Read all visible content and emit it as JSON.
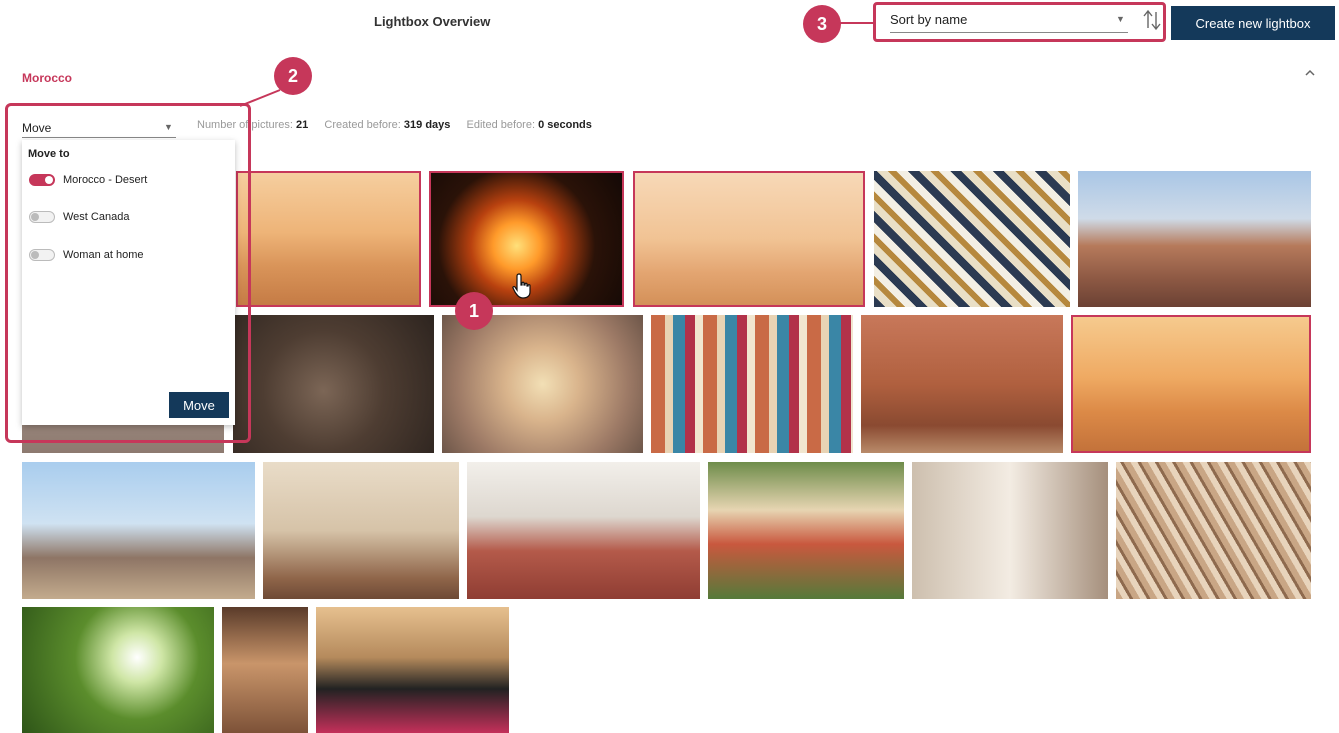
{
  "header": {
    "title": "Lightbox Overview",
    "sort_value": "Sort by name",
    "create_button": "Create new lightbox"
  },
  "callouts": {
    "one": "1",
    "two": "2",
    "three": "3"
  },
  "lightbox": {
    "name": "Morocco",
    "meta": {
      "pictures_label": "Number of pictures:",
      "pictures_value": "21",
      "created_label": "Created before:",
      "created_value": "319 days",
      "edited_label": "Edited before:",
      "edited_value": "0 seconds"
    }
  },
  "move_menu": {
    "select_value": "Move",
    "heading": "Move to",
    "options": [
      {
        "label": "Morocco - Desert",
        "on": true
      },
      {
        "label": "West Canada",
        "on": false
      },
      {
        "label": "Woman at home",
        "on": false
      }
    ],
    "button": "Move"
  },
  "colors": {
    "accent": "#c6375a",
    "primary": "#14395a"
  },
  "icons": {
    "sort_direction": "sort-arrows-icon",
    "collapse": "chevron-up-icon",
    "cursor": "hand-pointer-icon"
  }
}
